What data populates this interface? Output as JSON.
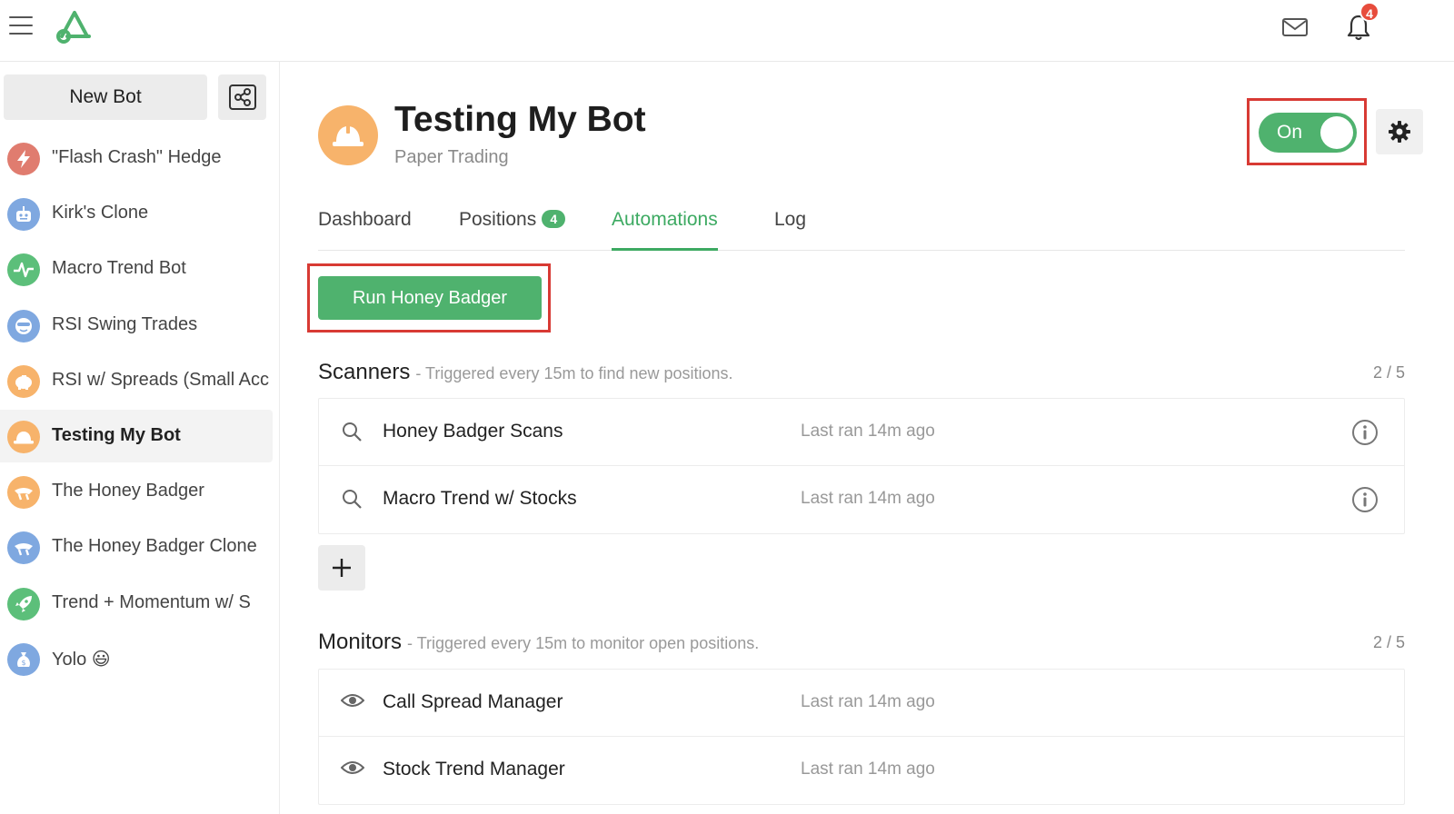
{
  "header": {
    "menu_icon": "hamburger-icon",
    "logo_icon": "app-logo",
    "mail_icon": "mail-icon",
    "bell_icon": "bell-icon",
    "notification_count": "4"
  },
  "sidebar": {
    "new_bot_label": "New Bot",
    "share_icon": "share-icon",
    "items": [
      {
        "label": "\"Flash Crash\" Hedge",
        "icon": "lightning-icon",
        "color": "#e07c6f"
      },
      {
        "label": "Kirk's Clone",
        "icon": "robot-icon",
        "color": "#7fa8e0"
      },
      {
        "label": "Macro Trend Bot",
        "icon": "pulse-icon",
        "color": "#5cbf7a"
      },
      {
        "label": "RSI Swing Trades",
        "icon": "face-icon",
        "color": "#7fa8e0"
      },
      {
        "label": "RSI w/ Spreads (Small Acc",
        "icon": "piggybank-icon",
        "color": "#f7b36b"
      },
      {
        "label": "Testing My Bot",
        "icon": "hardhat-icon",
        "color": "#f7b36b",
        "active": true
      },
      {
        "label": "The Honey Badger",
        "icon": "badger-icon",
        "color": "#f7b36b"
      },
      {
        "label": "The Honey Badger Clone",
        "icon": "badger-icon",
        "color": "#7fa8e0"
      },
      {
        "label": "Trend + Momentum w/ S",
        "icon": "rocket-icon",
        "color": "#5cbf7a"
      },
      {
        "label": "Yolo 😃",
        "icon": "moneybag-icon",
        "color": "#7fa8e0"
      }
    ]
  },
  "bot": {
    "title": "Testing My Bot",
    "subtitle": "Paper Trading",
    "icon": "hardhat-icon",
    "toggle_label": "On",
    "toggle_state": "on",
    "settings_icon": "gear-icon"
  },
  "tabs": [
    {
      "label": "Dashboard"
    },
    {
      "label": "Positions",
      "badge": "4"
    },
    {
      "label": "Automations",
      "active": true
    },
    {
      "label": "Log"
    }
  ],
  "run_button_label": "Run Honey Badger",
  "scanners": {
    "title": "Scanners",
    "description": "- Triggered every 15m to find new positions.",
    "count": "2 / 5",
    "items": [
      {
        "name": "Honey Badger Scans",
        "last_ran": "Last ran 14m ago",
        "icon": "search-icon"
      },
      {
        "name": "Macro Trend w/ Stocks",
        "last_ran": "Last ran 14m ago",
        "icon": "search-icon"
      }
    ]
  },
  "add_icon": "plus-icon",
  "monitors": {
    "title": "Monitors",
    "description": "- Triggered every 15m to monitor open positions.",
    "count": "2 / 5",
    "items": [
      {
        "name": "Call Spread Manager",
        "last_ran": "Last ran 14m ago",
        "icon": "eye-icon"
      },
      {
        "name": "Stock Trend Manager",
        "last_ran": "Last ran 14m ago",
        "icon": "eye-icon"
      }
    ]
  },
  "colors": {
    "accent_green": "#4fb26e",
    "highlight_red": "#d83a34",
    "badge_red": "#e74c3c"
  }
}
